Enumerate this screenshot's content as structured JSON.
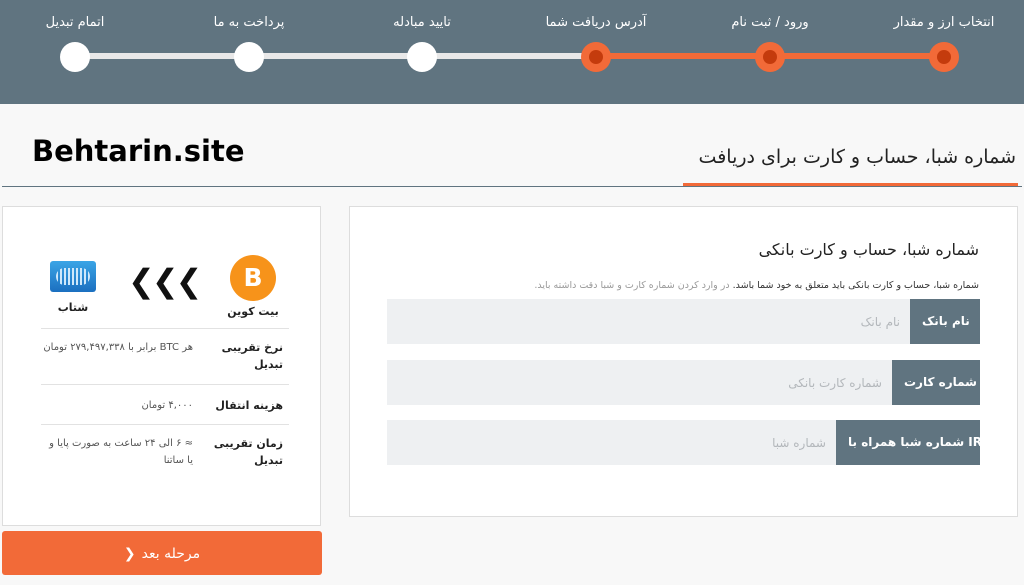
{
  "steps": [
    {
      "label": "انتخاب ارز و مقدار",
      "state": "done"
    },
    {
      "label": "ورود / ثبت نام",
      "state": "done"
    },
    {
      "label": "آدرس دریافت شما",
      "state": "current"
    },
    {
      "label": "تایید مبادله",
      "state": "pending"
    },
    {
      "label": "پرداخت به ما",
      "state": "pending"
    },
    {
      "label": "اتمام تبدیل",
      "state": "pending"
    }
  ],
  "brand": "Behtarin.site",
  "page_title": "شماره شبا، حساب و کارت برای دریافت",
  "summary": {
    "from_currency": {
      "name": "بیت کوین",
      "symbol": "B",
      "icon": "bitcoin-icon"
    },
    "to_currency": {
      "name": "شتاب",
      "icon": "bank-card-icon"
    },
    "direction_icon": "triple-chevron-left-icon",
    "rows": [
      {
        "label": "نرخ تقریبی تبدیل",
        "value": "هر BTC برابر با ۲۷۹,۴۹۷,۳۳۸ تومان"
      },
      {
        "label": "هزینه انتقال",
        "value": "۴,۰۰۰ تومان"
      },
      {
        "label": "زمان تقریبی تبدیل",
        "value": "≈ ۶ الی ۲۴ ساعت به صورت پایا و یا ساتنا"
      }
    ]
  },
  "next_button": {
    "label": "مرحله بعد",
    "icon": "chevron-left-icon"
  },
  "form": {
    "title": "شماره شبا، حساب و کارت بانکی",
    "note": "شماره شبا، حساب و کارت بانکی باید متعلق به خود شما باشد.",
    "note_muted": "در وارد کردن شماره کارت و شبا دقت داشته باید.",
    "fields": [
      {
        "label": "نام بانک",
        "placeholder": "نام بانک",
        "value": ""
      },
      {
        "label": "شماره کارت",
        "placeholder": "شماره کارت بانکی",
        "value": ""
      },
      {
        "label": "شماره شبا همراه با IR",
        "placeholder": "شماره شبا",
        "value": ""
      }
    ]
  },
  "colors": {
    "accent": "#f26a38",
    "header": "#607480",
    "bitcoin": "#f7931a"
  }
}
